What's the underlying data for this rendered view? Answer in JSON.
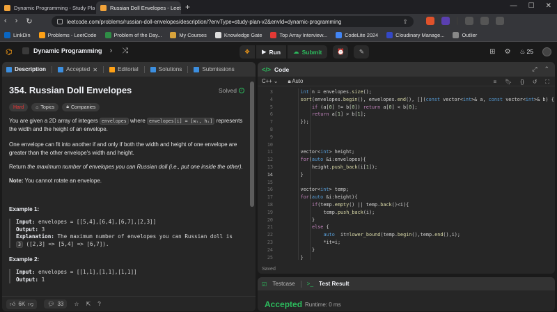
{
  "browser": {
    "tabs": [
      {
        "title": "Dynamic Programming - Study Plan"
      },
      {
        "title": "Russian Doll Envelopes - LeetC"
      }
    ],
    "url": "leetcode.com/problems/russian-doll-envelopes/description/?envType=study-plan-v2&envId=dynamic-programming",
    "bookmarks": [
      "LinkDin",
      "Problems - LeetCode",
      "Problem of the Day...",
      "My Courses",
      "Knowledge Gate",
      "Top Array Interview...",
      "CodeLite 2024",
      "Cloudinary Manage...",
      "Outlier"
    ]
  },
  "lcnav": {
    "study_plan": "Dynamic Programming",
    "run_label": "Run",
    "submit_label": "Submit",
    "streak": "25"
  },
  "left_tabs": {
    "description": "Description",
    "accepted": "Accepted",
    "editorial": "Editorial",
    "solutions": "Solutions",
    "submissions": "Submissions"
  },
  "problem": {
    "title": "354. Russian Doll Envelopes",
    "solved": "Solved",
    "difficulty": "Hard",
    "topics": "Topics",
    "companies": "Companies",
    "p1a": "You are given a 2D array of integers",
    "p1code1": "envelopes",
    "p1b": "where",
    "p1code2": "envelopes[i] = [wᵢ, hᵢ]",
    "p1c": "represents the width and the height of an envelope.",
    "p2": "One envelope can fit into another if and only if both the width and height of one envelope are greater than the other envelope's width and height.",
    "p3a": "Return ",
    "p3b": "the maximum number of envelopes you can Russian doll (i.e., put one inside the other).",
    "note_label": "Note:",
    "note_text": " You cannot rotate an envelope.",
    "ex1_title": "Example 1:",
    "ex1_input_label": "Input:",
    "ex1_input": " envelopes = [[5,4],[6,4],[6,7],[2,3]]",
    "ex1_output_label": "Output:",
    "ex1_output": " 3",
    "ex1_expl_label": "Explanation:",
    "ex1_expl": " The maximum number of envelopes you can Russian doll is",
    "ex1_expl2_code": "3",
    "ex1_expl2": " ([2,3] => [5,4] => [6,7]).",
    "ex2_title": "Example 2:",
    "ex2_input_label": "Input:",
    "ex2_input": " envelopes = [[1,1],[1,1],[1,1]]",
    "ex2_output_label": "Output:",
    "ex2_output": " 1"
  },
  "footer": {
    "likes": "6K",
    "comments": "33"
  },
  "code_panel": {
    "title": "Code",
    "language": "C++",
    "mode": "Auto",
    "status": "Saved",
    "lines": [
      {
        "n": "3",
        "indent": 1,
        "html": "<span class='t'>int</span> n = envelopes.<span class='f'>size</span>();"
      },
      {
        "n": "4",
        "indent": 1,
        "html": "<span class='f'>sort</span>(envelopes.<span class='f'>begin</span>(), envelopes.<span class='f'>end</span>(), [](<span class='t'>const</span> vector&lt;<span class='t'>int</span>&gt;&amp; a, <span class='t'>const</span> vector&lt;<span class='t'>int</span>&gt;&amp; b) {"
      },
      {
        "n": "5",
        "indent": 2,
        "html": "<span class='k'>if</span> (a[<span class='n'>0</span>] != b[<span class='n'>0</span>]) <span class='k'>return</span> a[<span class='n'>0</span>] &lt; b[<span class='n'>0</span>];"
      },
      {
        "n": "6",
        "indent": 2,
        "html": "<span class='k'>return</span> a[<span class='n'>1</span>] &gt; b[<span class='n'>1</span>];"
      },
      {
        "n": "7",
        "indent": 1,
        "html": "});"
      },
      {
        "n": "8",
        "indent": 0,
        "html": ""
      },
      {
        "n": "9",
        "indent": 0,
        "html": ""
      },
      {
        "n": "10",
        "indent": 0,
        "html": ""
      },
      {
        "n": "11",
        "indent": 1,
        "html": "vector&lt;<span class='t'>int</span>&gt; height;"
      },
      {
        "n": "12",
        "indent": 1,
        "html": "<span class='k'>for</span>(<span class='t'>auto</span> &amp;i:envelopes){"
      },
      {
        "n": "13",
        "indent": 2,
        "html": "height.<span class='f'>push_back</span>(i[<span class='n'>1</span>]);"
      },
      {
        "n": "14",
        "indent": 1,
        "html": "}"
      },
      {
        "n": "15",
        "indent": 0,
        "html": ""
      },
      {
        "n": "16",
        "indent": 1,
        "html": "vector&lt;<span class='t'>int</span>&gt; temp;"
      },
      {
        "n": "17",
        "indent": 1,
        "html": "<span class='k'>for</span>(<span class='t'>auto</span> &amp;i:height){"
      },
      {
        "n": "18",
        "indent": 2,
        "html": "<span class='k'>if</span>(temp.<span class='f'>empty</span>() || temp.<span class='f'>back</span>()&lt;i){"
      },
      {
        "n": "19",
        "indent": 3,
        "html": "temp.<span class='f'>push_back</span>(i);"
      },
      {
        "n": "20",
        "indent": 2,
        "html": "}"
      },
      {
        "n": "21",
        "indent": 2,
        "html": "<span class='k'>else</span> {"
      },
      {
        "n": "22",
        "indent": 3,
        "html": "<span class='t'>auto</span>  it=<span class='f'>lower_bound</span>(temp.<span class='f'>begin</span>(),temp.<span class='f'>end</span>(),i);"
      },
      {
        "n": "23",
        "indent": 3,
        "html": "*it=i;"
      },
      {
        "n": "24",
        "indent": 2,
        "html": "}"
      },
      {
        "n": "25",
        "indent": 1,
        "html": "}"
      },
      {
        "n": "26",
        "indent": 0,
        "html": ""
      },
      {
        "n": "27",
        "indent": 1,
        "html": "<span class='k'>return</span> temp.<span class='f'>size</span>();"
      }
    ],
    "current_line": "14"
  },
  "result_panel": {
    "testcase_tab": "Testcase",
    "result_tab": "Test Result",
    "verdict": "Accepted",
    "runtime": "Runtime: 0 ms"
  },
  "colors": {
    "accent": "#ffa116",
    "success": "#2cbb5d",
    "hard": "#f63636",
    "panel": "#262626",
    "background": "#1a1a1a"
  }
}
